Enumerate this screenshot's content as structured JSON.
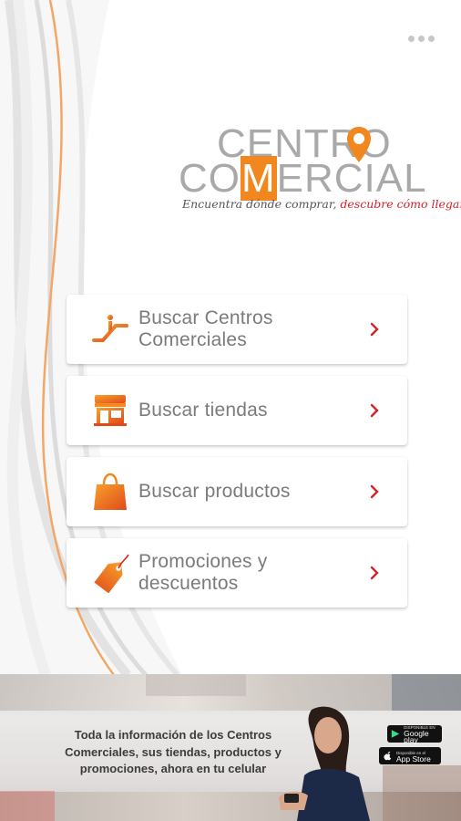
{
  "header": {
    "more_icon": "more-dots-icon"
  },
  "logo": {
    "line1": "CENTRO",
    "line2_pre": "CO",
    "line2_m": "M",
    "line2_post": "ERCIAL",
    "tagline_main": "Encuentra dónde comprar, ",
    "tagline_accent": "descubre cómo llegar."
  },
  "menu": {
    "items": [
      {
        "label": "Buscar Centros Comerciales",
        "icon": "escalator-icon"
      },
      {
        "label": "Buscar tiendas",
        "icon": "storefront-icon"
      },
      {
        "label": "Buscar productos",
        "icon": "shopping-bag-icon"
      },
      {
        "label": "Promociones y descuentos",
        "icon": "price-tag-icon"
      }
    ],
    "chevron_icon": "chevron-right-icon"
  },
  "banner": {
    "text_line1": "Toda la información de los Centros",
    "text_line2": "Comerciales, sus tiendas, productos y",
    "text_line3": "promociones, ahora en tu celular",
    "google_small": "DISPONIBLE EN",
    "google_big": "Google play",
    "apple_small": "Disponible en el",
    "apple_big": "App Store"
  },
  "colors": {
    "accent_orange": "#f0881f",
    "accent_red": "#d2232a",
    "text_gray": "#7b7b7b"
  }
}
